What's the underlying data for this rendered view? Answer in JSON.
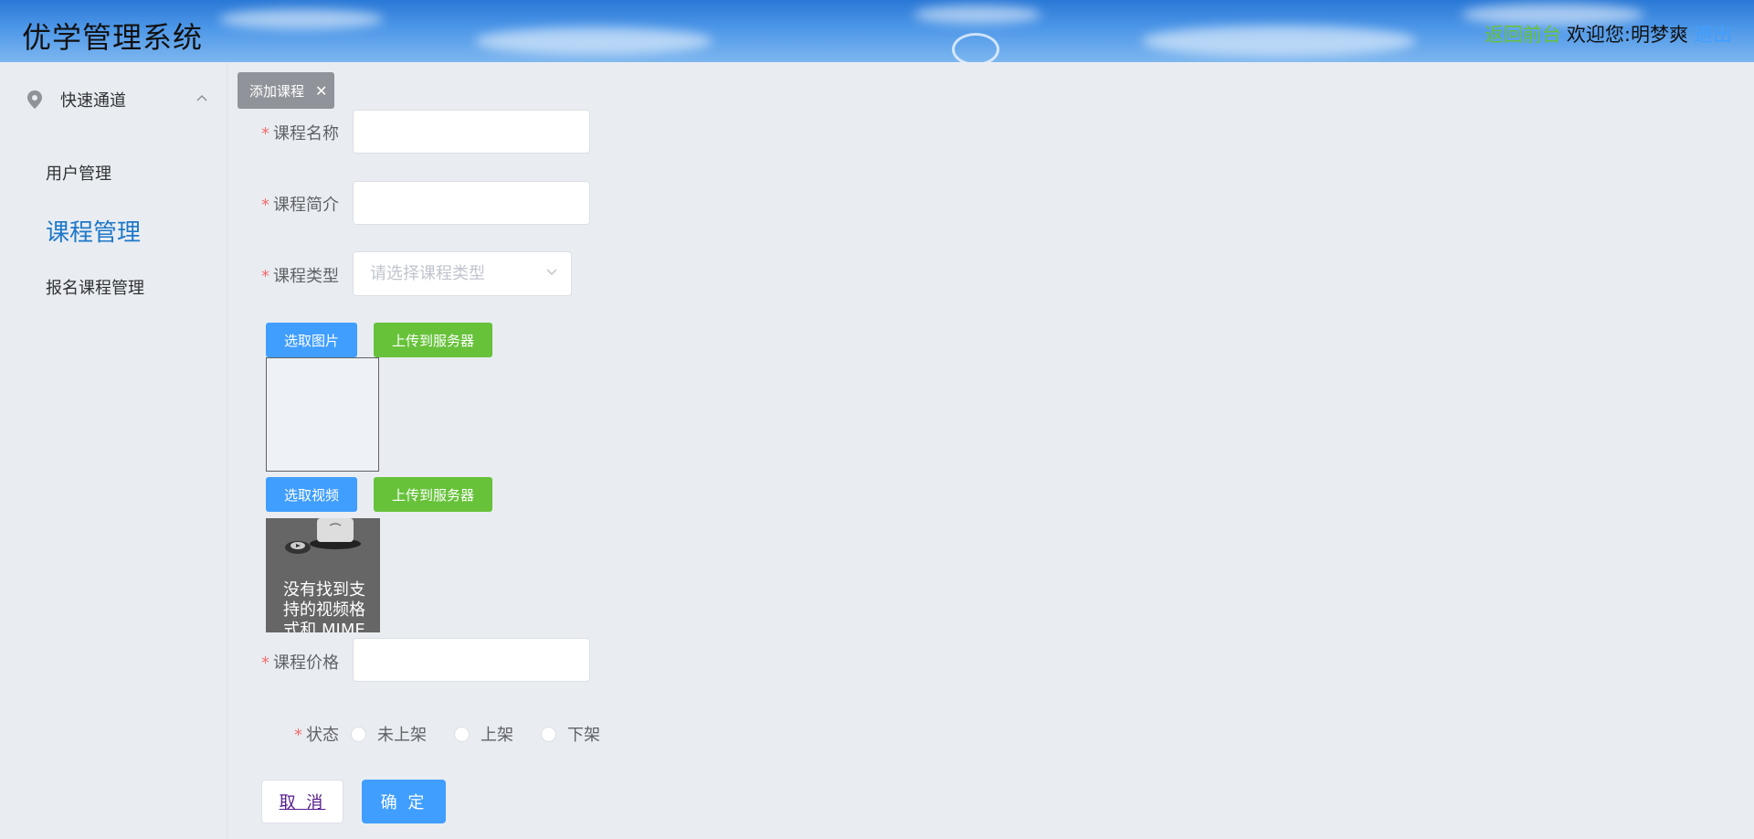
{
  "header": {
    "app_title": "优学管理系统",
    "back_to_front": "返回前台",
    "welcome": "欢迎您:明梦爽",
    "logout": "退出"
  },
  "sidebar": {
    "group_label": "快速通道",
    "items": [
      {
        "label": "用户管理"
      },
      {
        "label": "课程管理",
        "active": true
      },
      {
        "label": "报名课程管理"
      }
    ]
  },
  "tab": {
    "label": "添加课程"
  },
  "form": {
    "name_label": "课程名称",
    "intro_label": "课程简介",
    "type_label": "课程类型",
    "type_placeholder": "请选择课程类型",
    "pick_image": "选取图片",
    "upload_server": "上传到服务器",
    "pick_video": "选取视频",
    "upload_server_video": "上传到服务器",
    "video_error": "没有找到支持的视频格式和 MIME",
    "price_label": "课程价格",
    "status_label": "状态",
    "status_options": [
      "未上架",
      "上架",
      "下架"
    ],
    "cancel": "取 消",
    "confirm": "确 定"
  },
  "colors": {
    "primary": "#409eff",
    "success": "#67c23a",
    "required": "#f56c6c",
    "active_nav": "#1e78c8"
  }
}
